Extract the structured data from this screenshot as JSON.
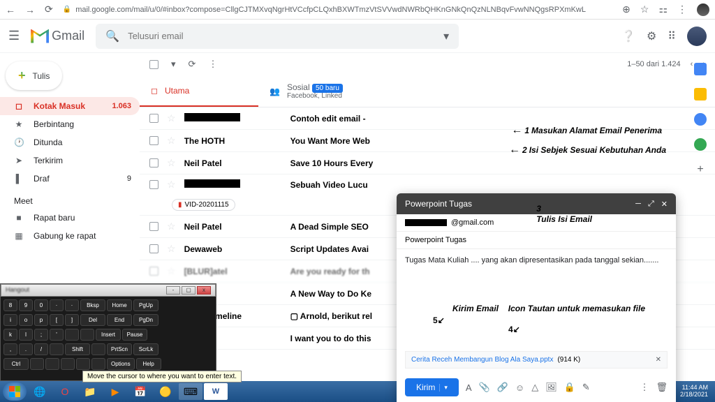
{
  "browser": {
    "url": "mail.google.com/mail/u/0/#inbox?compose=CllgCJTMXvqNgrHtVCcfpCLQxhBXWTmzVtSVVwdNWRbQHKnGNkQnQzNLNBqvFvwNNQgsRPXmKwL"
  },
  "app": {
    "name": "Gmail"
  },
  "search": {
    "placeholder": "Telusuri email"
  },
  "compose_btn": "Tulis",
  "sidebar": {
    "items": [
      {
        "icon": "▢",
        "label": "Kotak Masuk",
        "count": "1.063",
        "active": true
      },
      {
        "icon": "★",
        "label": "Berbintang"
      },
      {
        "icon": "🕐",
        "label": "Ditunda"
      },
      {
        "icon": "➤",
        "label": "Terkirim"
      },
      {
        "icon": "▌",
        "label": "Draf",
        "count": "9"
      }
    ],
    "meet_label": "Meet",
    "meet_items": [
      {
        "icon": "■",
        "label": "Rapat baru"
      },
      {
        "icon": "▦",
        "label": "Gabung ke rapat"
      }
    ]
  },
  "toolbar": {
    "pagination": "1–50 dari 1.424"
  },
  "tabs": {
    "primary": "Utama",
    "social": {
      "label": "Sosial",
      "badge": "50 baru",
      "sub": "Facebook, Linked"
    }
  },
  "emails": [
    {
      "sender": "[REDACTED]",
      "subject": "Contoh edit email - "
    },
    {
      "sender": "The HOTH",
      "subject": "You Want More Web"
    },
    {
      "sender": "Neil Patel",
      "subject": "Save 10 Hours Every"
    },
    {
      "sender": "[REDACTED]",
      "subject": "Sebuah Video Lucu",
      "attachment": "VID-20201115"
    },
    {
      "sender": "Neil Patel",
      "subject": "A Dead Simple SEO"
    },
    {
      "sender": "Dewaweb",
      "subject": "Script Updates Avai"
    },
    {
      "sender": "[BLUR]atel",
      "subject": "Are you ready for th"
    },
    {
      "sender": "tel",
      "subject": "A New Way to Do Ke"
    },
    {
      "sender": "Maps Timeline",
      "subject": "▢ Arnold, berikut rel"
    },
    {
      "sender": "",
      "subject": "I want you to do this"
    }
  ],
  "compose": {
    "title": "Powerpoint Tugas",
    "to_suffix": "@gmail.com",
    "subject": "Powerpoint Tugas",
    "body": "Tugas Mata Kuliah .... yang akan dipresentasikan pada tanggal sekian.......",
    "attachment": {
      "name": "Cerita Receh Membangun Blog Ala Saya.pptx",
      "size": "(914 K)"
    },
    "send": "Kirim"
  },
  "annotations": {
    "a1": "Masukan Alamat Email Penerima",
    "a2": "Isi Sebjek Sesuai Kebutuhan Anda",
    "a3": "Tulis Isi Email",
    "a4": "Icon Tautan untuk memasukan file",
    "a5": "Kirim Email",
    "n1": "1",
    "n2": "2",
    "n3": "3",
    "n4": "4",
    "n5": "5"
  },
  "keyboard": {
    "tooltip": "Move the cursor to where you want to enter text.",
    "row1": [
      "8",
      "9",
      "0",
      "·",
      "·",
      "Bksp",
      "Home",
      "PgUp"
    ],
    "row2": [
      "i",
      "o",
      "p",
      "[",
      "]",
      "Del",
      "End",
      "PgDn"
    ],
    "row3": [
      "k",
      "l",
      ";",
      "'",
      "",
      "",
      "Insert",
      "Pause"
    ],
    "row4": [
      ",",
      ".",
      "/",
      "",
      "Shift",
      "",
      "PrtScn",
      "ScrLk"
    ],
    "row5": [
      "Ctrl",
      "",
      "",
      "",
      "",
      "",
      "Options",
      "Help"
    ]
  },
  "clock": {
    "time": "11:44 AM",
    "date": "2/18/2021"
  }
}
